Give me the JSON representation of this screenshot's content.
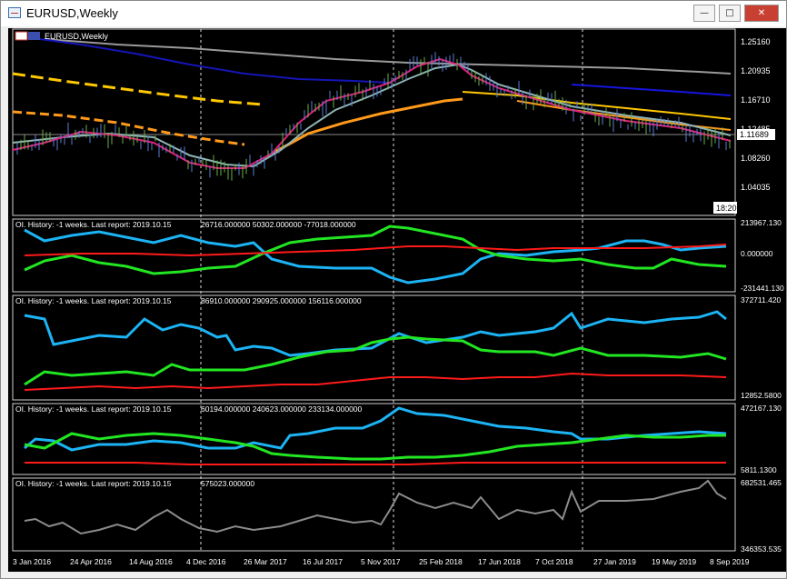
{
  "window": {
    "title": "EURUSD,Weekly",
    "btn_minimize": "—",
    "btn_maximize": "□",
    "btn_close": "✕"
  },
  "chart": {
    "symbol_label": "EURUSD,Weekly",
    "price_ticks": [
      "1.25160",
      "1.20935",
      "1.16710",
      "1.12485",
      "1.08260",
      "1.04035"
    ],
    "current_price": "1.11689",
    "time_label": "18:20",
    "x_ticks": [
      "3 Jan 2016",
      "24 Apr 2016",
      "14 Aug 2016",
      "4 Dec 2016",
      "26 Mar 2017",
      "16 Jul 2017",
      "5 Nov 2017",
      "25 Feb 2018",
      "17 Jun 2018",
      "7 Oct 2018",
      "27 Jan 2019",
      "19 May 2019",
      "8 Sep 2019"
    ]
  },
  "panels": [
    {
      "header": "OI. History: -1 weeks. Last report: 2019.10.15",
      "values": "26716.000000 50302.000000 -77018.000000",
      "scale_top": "213967.130",
      "scale_mid": "0.000000",
      "scale_bottom": "-231441.130"
    },
    {
      "header": "OI. History: -1 weeks. Last report: 2019.10.15",
      "values": "86910.000000 290925.000000 156116.000000",
      "scale_top": "372711.420",
      "scale_bottom": "12852.5800"
    },
    {
      "header": "OI. History: -1 weeks. Last report: 2019.10.15",
      "values": "60194.000000 240623.000000 233134.000000",
      "scale_top": "472167.130",
      "scale_bottom": "5811.1300"
    },
    {
      "header": "OI. History: -1 weeks. Last report: 2019.10.15",
      "values": "575023.000000",
      "scale_top": "682531.465",
      "scale_bottom": "346353.535"
    }
  ],
  "colors": {
    "blue": "#1cb4f4",
    "green": "#22e622",
    "red": "#ff1a1a",
    "gray": "#8c8c8c",
    "grid": "#ffffff"
  }
}
